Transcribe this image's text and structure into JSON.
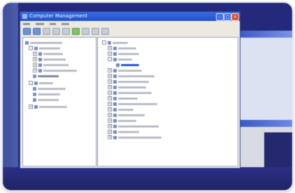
{
  "window": {
    "title": "Computer Management"
  },
  "colors": {
    "desktop": "#25297c",
    "titlebar": "#1e4fc7",
    "selection": "#2a55c8"
  },
  "icons": [
    "computer-icon",
    "minimize-icon",
    "maximize-icon",
    "close-icon",
    "folder-icon",
    "device-icon"
  ]
}
